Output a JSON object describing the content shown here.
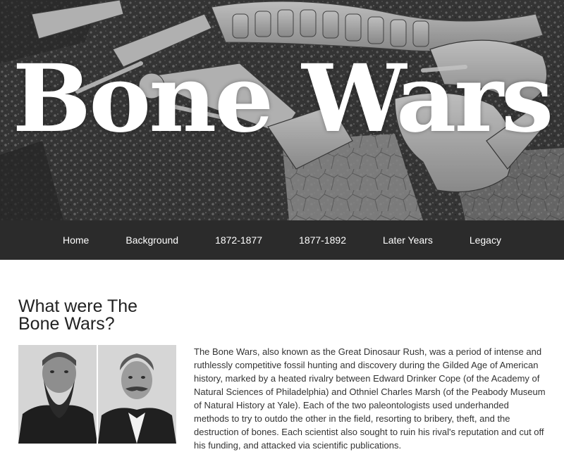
{
  "hero": {
    "title": "Bone Wars"
  },
  "nav": {
    "items": [
      {
        "label": "Home"
      },
      {
        "label": "Background"
      },
      {
        "label": "1872-1877"
      },
      {
        "label": "1877-1892"
      },
      {
        "label": "Later Years"
      },
      {
        "label": "Legacy"
      }
    ]
  },
  "main": {
    "heading": "What were The Bone Wars?",
    "body": "The Bone Wars, also known as the Great Dinosaur Rush, was a period of intense and ruthlessly competitive fossil hunting and discovery during the Gilded Age of American history, marked by a heated rivalry between Edward Drinker Cope (of the Academy of Natural Sciences of Philadelphia) and Othniel Charles Marsh (of the Peabody Museum of Natural History at Yale). Each of the two paleontologists used underhanded methods to try to outdo the other in the field, resorting to bribery, theft, and the destruction of bones. Each scientist also sought to ruin his rival's reputation and cut off his funding, and attacked via scientific publications."
  },
  "colors": {
    "navbar_bg": "#2b2b2b",
    "nav_text": "#ffffff",
    "hero_title": "#ffffff",
    "page_bg": "#ffffff",
    "heading_text": "#222222",
    "body_text": "#333333"
  }
}
